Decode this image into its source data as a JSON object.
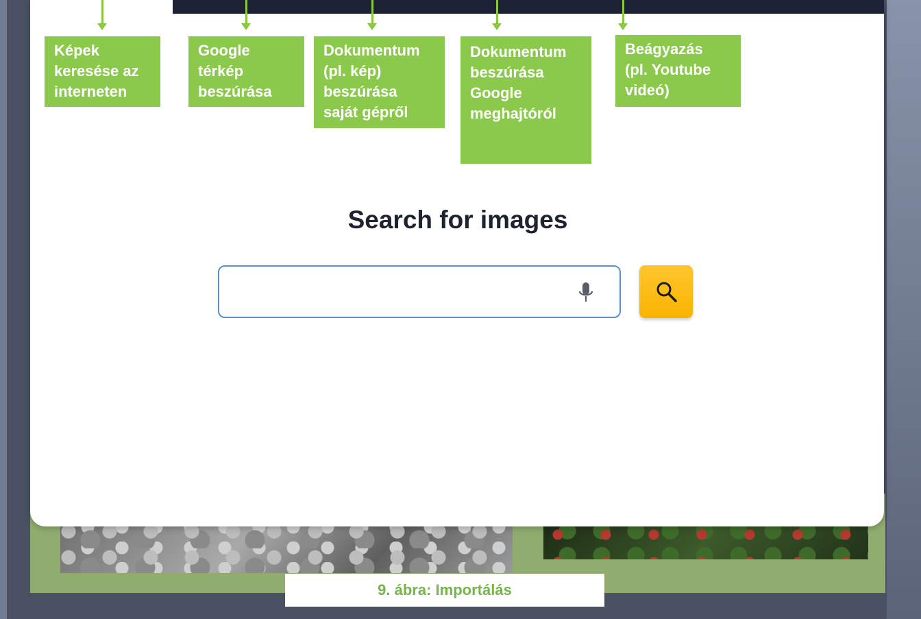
{
  "callouts": [
    {
      "name": "callout-search-web-images",
      "text": "Képek\nkeresése az\ninterneten"
    },
    {
      "name": "callout-insert-google-map",
      "text": "Google\ntérkép\nbeszúrása"
    },
    {
      "name": "callout-upload-from-computer",
      "text": "Dokumentum\n(pl. kép)\nbeszúrása\nsaját gépről"
    },
    {
      "name": "callout-insert-from-google-drive",
      "text": "Dokumentum\nbeszúrása\nGoogle\nmeghajtóról"
    },
    {
      "name": "callout-embed",
      "text": "Beágyazás\n(pl. Youtube\nvideó)"
    }
  ],
  "search": {
    "title": "Search for images",
    "value": "",
    "placeholder": "",
    "mic_icon": "microphone-icon",
    "button_icon": "search-icon"
  },
  "colors": {
    "callout_bg": "#8bc94c",
    "search_button": "#ffc52e",
    "caption_text": "#76b54a"
  },
  "caption": "9. ábra: Importálás"
}
